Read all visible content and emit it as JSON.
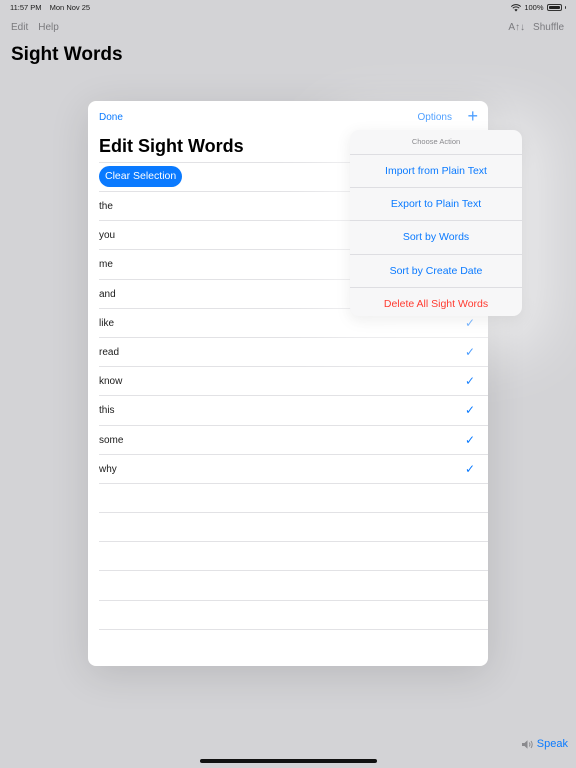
{
  "status": {
    "time": "11:57 PM",
    "date": "Mon Nov 25",
    "battery": "100%"
  },
  "menu": {
    "edit": "Edit",
    "help": "Help"
  },
  "toolbar": {
    "sort_glyph": "A↑↓",
    "shuffle": "Shuffle"
  },
  "app_title": "Sight Words",
  "sheet": {
    "done": "Done",
    "options": "Options",
    "add": "+",
    "title": "Edit Sight Words",
    "clear_selection": "Clear Selection",
    "words": [
      {
        "text": "the",
        "checked": false
      },
      {
        "text": "you",
        "checked": false
      },
      {
        "text": "me",
        "checked": false
      },
      {
        "text": "and",
        "checked": false
      },
      {
        "text": "like",
        "checked": true
      },
      {
        "text": "read",
        "checked": true
      },
      {
        "text": "know",
        "checked": true
      },
      {
        "text": "this",
        "checked": true
      },
      {
        "text": "some",
        "checked": true
      },
      {
        "text": "why",
        "checked": true
      }
    ],
    "check_glyph": "✓"
  },
  "popover": {
    "caption": "Choose Action",
    "actions": [
      "Import from Plain Text",
      "Export to Plain Text",
      "Sort by Words",
      "Sort by Create Date",
      "Delete All Sight Words"
    ]
  },
  "speak": "Speak",
  "colors": {
    "accent": "#0a7aff",
    "destructive": "#ff3b30"
  }
}
